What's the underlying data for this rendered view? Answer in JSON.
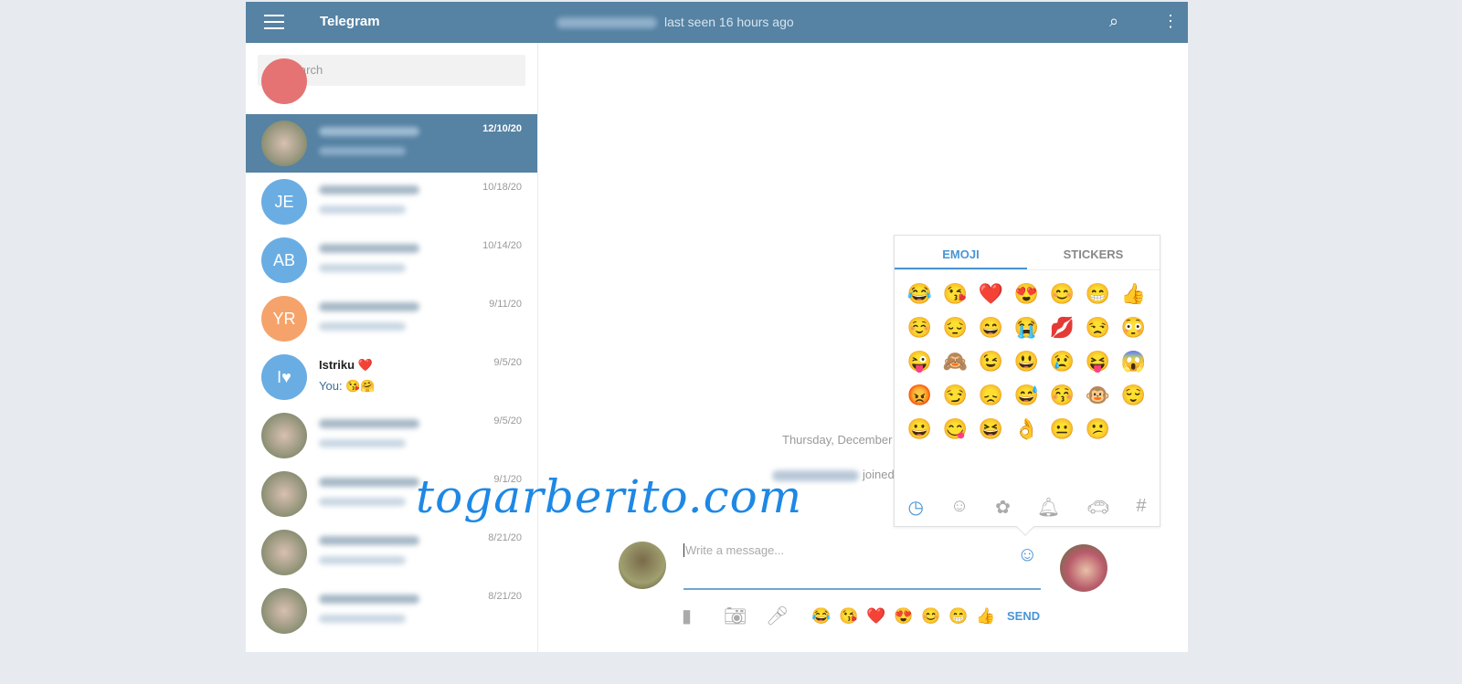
{
  "header": {
    "title": "Telegram",
    "status": "last seen 16 hours ago"
  },
  "search": {
    "placeholder": "Search"
  },
  "chats": [
    {
      "date": "12/10/20",
      "avatar": "photo",
      "selected": true
    },
    {
      "date": "10/18/20",
      "initials": "JE",
      "color": "#6aade3"
    },
    {
      "date": "10/14/20",
      "initials": "AB",
      "color": "#6aade3"
    },
    {
      "date": "9/11/20",
      "initials": "YR",
      "color": "#f5a36b"
    },
    {
      "date": "9/5/20",
      "initials": "I♥",
      "color": "#6aade3",
      "name": "Istriku ❤️",
      "message": "You: 😘🤗"
    },
    {
      "date": "9/5/20",
      "avatar": "photo"
    },
    {
      "date": "9/1/20",
      "avatar": "photo"
    },
    {
      "date": "8/21/20",
      "avatar": "photo"
    },
    {
      "date": "8/21/20",
      "avatar": "photo"
    }
  ],
  "chat": {
    "day": "Thursday, December",
    "joined": "joined"
  },
  "emoji_panel": {
    "tabs": [
      "EMOJI",
      "STICKERS"
    ],
    "active_tab": "EMOJI",
    "emojis": [
      "😂",
      "😘",
      "❤️",
      "😍",
      "😊",
      "😁",
      "👍",
      "☺️",
      "😔",
      "😄",
      "😭",
      "💋",
      "😒",
      "😳",
      "😜",
      "🙈",
      "😉",
      "😃",
      "😢",
      "😝",
      "😱",
      "😡",
      "😏",
      "😞",
      "😅",
      "😚",
      "🐵",
      "😌",
      "😀",
      "😋",
      "😆",
      "👌",
      "😐",
      "😕"
    ],
    "categories": [
      "clock-icon",
      "smiley-icon",
      "flower-icon",
      "bell-icon",
      "car-icon",
      "hash-icon"
    ]
  },
  "composer": {
    "placeholder": "Write a message...",
    "send": "SEND",
    "quick_emojis": [
      "😂",
      "😘",
      "❤️",
      "😍",
      "😊",
      "😁",
      "👍"
    ]
  },
  "watermark": "togarberito.com",
  "colors": {
    "header": "#5682a3",
    "accent": "#4a95d6"
  }
}
